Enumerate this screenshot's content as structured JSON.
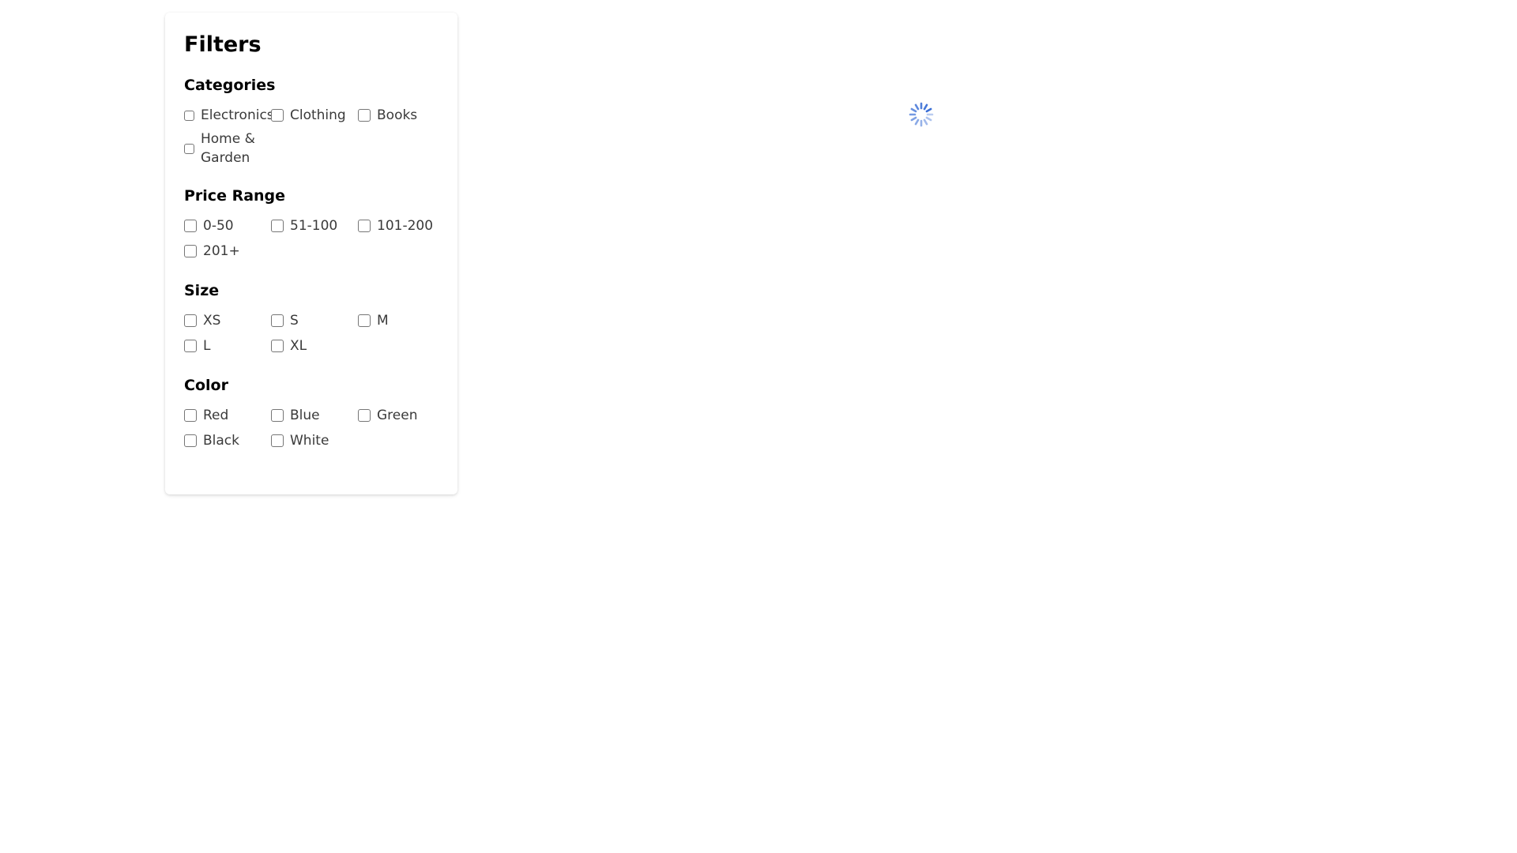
{
  "filters": {
    "title": "Filters",
    "groups": [
      {
        "title": "Categories",
        "options": [
          {
            "label": "Electronics",
            "checked": false
          },
          {
            "label": "Clothing",
            "checked": false
          },
          {
            "label": "Books",
            "checked": false
          },
          {
            "label": "Home & Garden",
            "checked": false
          }
        ]
      },
      {
        "title": "Price Range",
        "options": [
          {
            "label": "0-50",
            "checked": false
          },
          {
            "label": "51-100",
            "checked": false
          },
          {
            "label": "101-200",
            "checked": false
          },
          {
            "label": "201+",
            "checked": false
          }
        ]
      },
      {
        "title": "Size",
        "options": [
          {
            "label": "XS",
            "checked": false
          },
          {
            "label": "S",
            "checked": false
          },
          {
            "label": "M",
            "checked": false
          },
          {
            "label": "L",
            "checked": false
          },
          {
            "label": "XL",
            "checked": false
          }
        ]
      },
      {
        "title": "Color",
        "options": [
          {
            "label": "Red",
            "checked": false
          },
          {
            "label": "Blue",
            "checked": false
          },
          {
            "label": "Green",
            "checked": false
          },
          {
            "label": "Black",
            "checked": false
          },
          {
            "label": "White",
            "checked": false
          }
        ]
      }
    ]
  },
  "loading": {
    "icon": "spinner-icon",
    "color": "#3b6fd6"
  }
}
